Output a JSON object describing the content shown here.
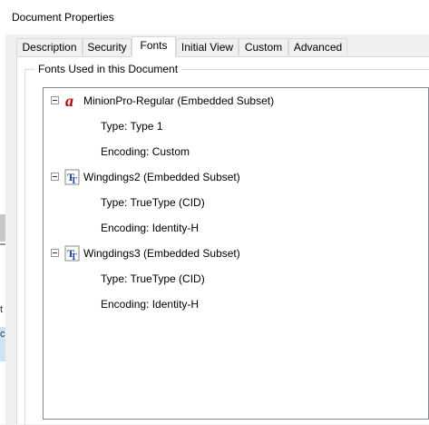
{
  "window": {
    "title": "Document Properties"
  },
  "tabs": [
    {
      "label": "Description",
      "active": false
    },
    {
      "label": "Security",
      "active": false
    },
    {
      "label": "Fonts",
      "active": true
    },
    {
      "label": "Initial View",
      "active": false
    },
    {
      "label": "Custom",
      "active": false
    },
    {
      "label": "Advanced",
      "active": false
    }
  ],
  "fonts_group": {
    "label": "Fonts Used in this Document"
  },
  "fonts": [
    {
      "name": "MinionPro-Regular (Embedded Subset)",
      "icon": "opentype-font-icon",
      "type": "Type: Type 1",
      "encoding": "Encoding: Custom"
    },
    {
      "name": "Wingdings2 (Embedded Subset)",
      "icon": "truetype-font-icon",
      "type": "Type: TrueType (CID)",
      "encoding": "Encoding: Identity-H"
    },
    {
      "name": "Wingdings3 (Embedded Subset)",
      "icon": "truetype-font-icon",
      "type": "Type: TrueType (CID)",
      "encoding": "Encoding: Identity-H"
    }
  ],
  "background_window": {
    "fragments": [
      "t",
      "c"
    ]
  },
  "colors": {
    "opentype_icon": "#cc0000",
    "truetype_icon": "#1f3fb5",
    "active_tab": "#ffffff"
  }
}
